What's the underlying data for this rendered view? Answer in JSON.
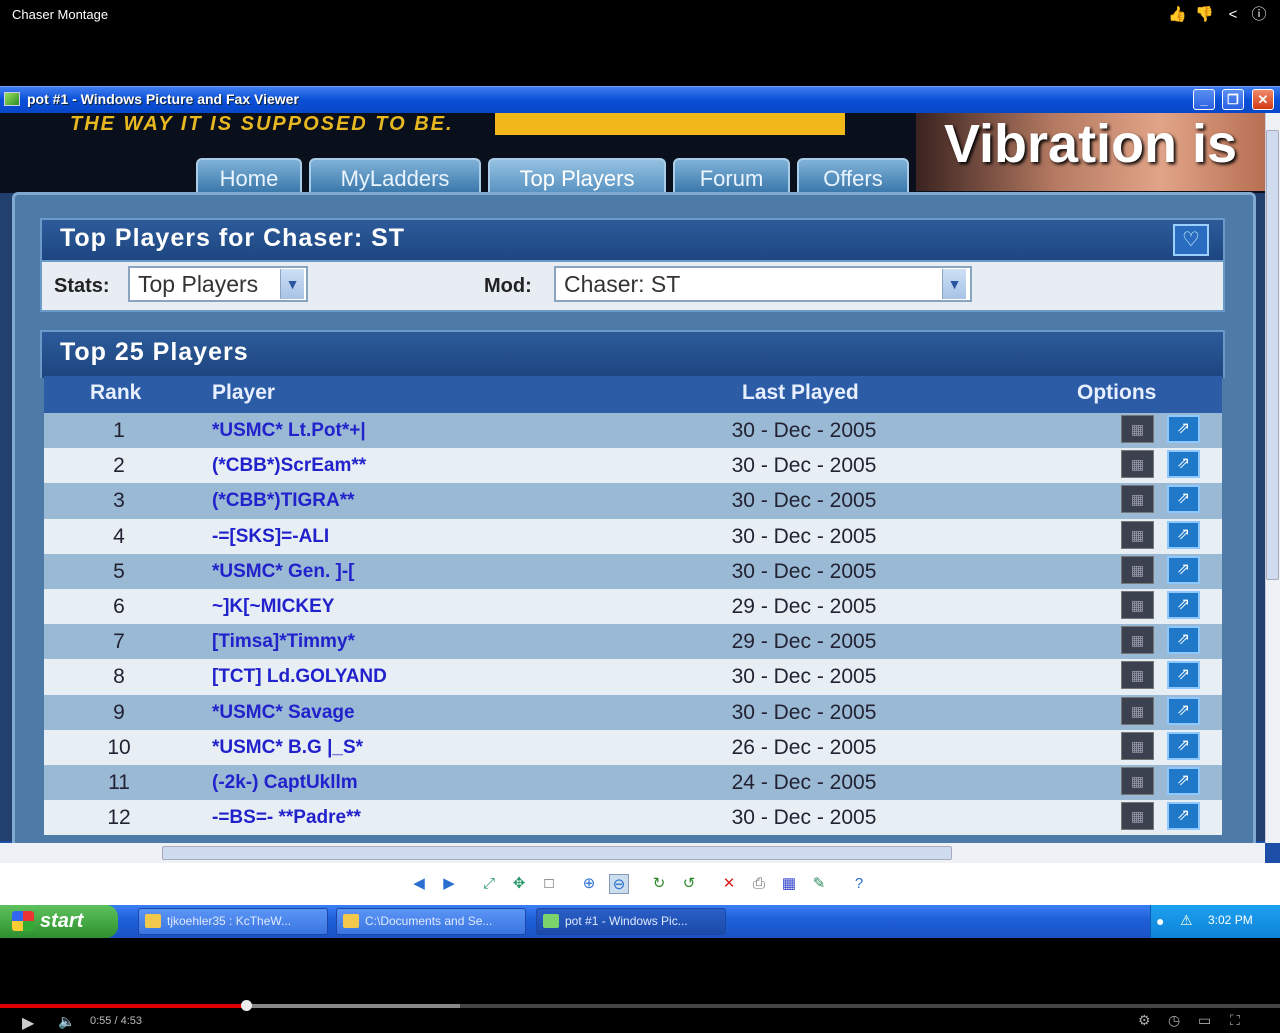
{
  "youtube": {
    "title": "Chaser Montage",
    "time": "0:55 / 4:53",
    "progress_fraction": 0.192,
    "icons": [
      "like-icon",
      "dislike-icon",
      "share-icon",
      "info-icon"
    ]
  },
  "window": {
    "title": "pot #1 - Windows Picture and Fax Viewer"
  },
  "site": {
    "slogan": "THE WAY IT IS SUPPOSED TO BE.",
    "ad_text": "Vibration is",
    "nav": [
      "Home",
      "MyLadders",
      "Top Players",
      "Forum",
      "Offers"
    ]
  },
  "panel1": {
    "title": "Top Players for Chaser: ST",
    "stats_label": "Stats:",
    "stats_value": "Top Players",
    "mod_label": "Mod:",
    "mod_value": "Chaser: ST"
  },
  "panel2": {
    "title": "Top 25 Players",
    "columns": [
      "Rank",
      "Player",
      "Last Played",
      "Options"
    ],
    "rows": [
      {
        "rank": "1",
        "player": "*USMC* Lt.Pot*+|",
        "date": "30 - Dec - 2005"
      },
      {
        "rank": "2",
        "player": "(*CBB*)ScrEam**",
        "date": "30 - Dec - 2005"
      },
      {
        "rank": "3",
        "player": "(*CBB*)TIGRA**",
        "date": "30 - Dec - 2005"
      },
      {
        "rank": "4",
        "player": "-=[SKS]=-ALI",
        "date": "30 - Dec - 2005"
      },
      {
        "rank": "5",
        "player": "*USMC* Gen. ]-[",
        "date": "30 - Dec - 2005"
      },
      {
        "rank": "6",
        "player": "~]K[~MICKEY",
        "date": "29 - Dec - 2005"
      },
      {
        "rank": "7",
        "player": "[Timsa]*Timmy*",
        "date": "29 - Dec - 2005"
      },
      {
        "rank": "8",
        "player": "[TCT] Ld.GOLYAND",
        "date": "30 - Dec - 2005"
      },
      {
        "rank": "9",
        "player": "*USMC* Savage",
        "date": "30 - Dec - 2005"
      },
      {
        "rank": "10",
        "player": "*USMC* B.G |_S*",
        "date": "26 - Dec - 2005"
      },
      {
        "rank": "11",
        "player": "(-2k-) CaptUkllm",
        "date": "24 - Dec - 2005"
      },
      {
        "rank": "12",
        "player": "-=BS=- **Padre**",
        "date": "30 - Dec - 2005"
      }
    ]
  },
  "taskbar": {
    "start": "start",
    "tasks": [
      "tjkoehler35 : KcTheW...",
      "C:\\Documents and Se...",
      "pot #1 - Windows Pic..."
    ],
    "clock": "3:02 PM"
  }
}
